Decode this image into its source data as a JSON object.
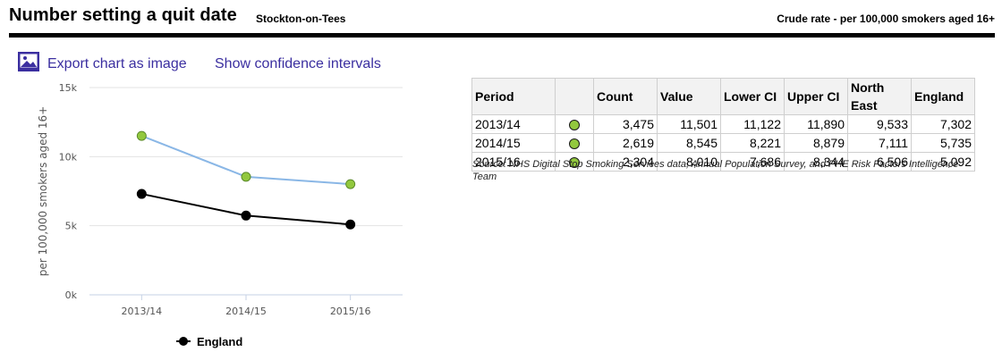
{
  "header": {
    "title": "Number setting a quit date",
    "area": "Stockton-on-Tees",
    "metric": "Crude rate - per 100,000 smokers aged 16+"
  },
  "links": {
    "export_label": "Export chart as image",
    "ci_label": "Show confidence intervals"
  },
  "colors": {
    "area_line": "#8ab7e6",
    "area_marker": "#92c83e",
    "england_line": "#000000",
    "link": "#3b2fa0"
  },
  "chart_data": {
    "type": "line",
    "categories": [
      "2013/14",
      "2014/15",
      "2015/16"
    ],
    "series": [
      {
        "key": "area",
        "values": [
          11501,
          8545,
          8010
        ]
      },
      {
        "key": "england",
        "name": "England",
        "values": [
          7302,
          5735,
          5092
        ]
      }
    ],
    "ylabel": "per 100,000 smokers aged 16+",
    "ylim": [
      0,
      15000
    ],
    "yticks": [
      0,
      5000,
      10000,
      15000
    ],
    "ytick_labels": [
      "0k",
      "5k",
      "10k",
      "15k"
    ],
    "grid": true,
    "legend": "bottom"
  },
  "table": {
    "headers": [
      "Period",
      "",
      "Count",
      "Value",
      "Lower CI",
      "Upper CI",
      "North East",
      "England"
    ],
    "rows": [
      {
        "period": "2013/14",
        "count": "3,475",
        "value": "11,501",
        "lower_ci": "11,122",
        "upper_ci": "11,890",
        "north_east": "9,533",
        "england": "7,302"
      },
      {
        "period": "2014/15",
        "count": "2,619",
        "value": "8,545",
        "lower_ci": "8,221",
        "upper_ci": "8,879",
        "north_east": "7,111",
        "england": "5,735"
      },
      {
        "period": "2015/16",
        "count": "2,304",
        "value": "8,010",
        "lower_ci": "7,686",
        "upper_ci": "8,344",
        "north_east": "6,506",
        "england": "5,092"
      }
    ]
  },
  "source": "Source: NHS Digital Stop Smoking Services data, Annual Population Survey, and PHE Risk Factors Intelligence Team"
}
